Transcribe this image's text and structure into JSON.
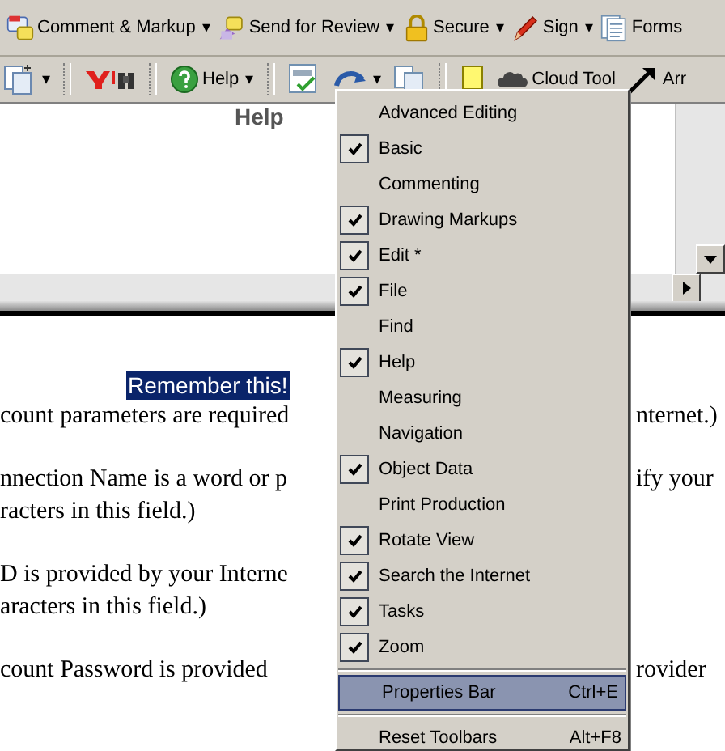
{
  "toolbar_top": [
    {
      "kind": "comment",
      "label": "Comment & Markup",
      "caret": "▾"
    },
    {
      "kind": "review",
      "label": "Send for Review",
      "caret": "▾"
    },
    {
      "kind": "lock",
      "label": "Secure",
      "caret": "▾"
    },
    {
      "kind": "pen",
      "label": "Sign",
      "caret": "▾"
    },
    {
      "kind": "forms",
      "label": "Forms"
    }
  ],
  "toolbar_second": [
    {
      "kind": "page",
      "caret": "▾"
    },
    {
      "kind": "sep"
    },
    {
      "kind": "search"
    },
    {
      "kind": "sep"
    },
    {
      "kind": "help",
      "label": "Help",
      "caret": "▾"
    },
    {
      "kind": "sep"
    },
    {
      "kind": "spell"
    },
    {
      "kind": "rotate",
      "caret": "▾"
    },
    {
      "kind": "copy"
    },
    {
      "kind": "sep"
    },
    {
      "kind": "note"
    },
    {
      "kind": "cloud",
      "label": "Cloud Tool"
    },
    {
      "kind": "arrow",
      "label": "Arr"
    }
  ],
  "upper_document": {
    "heading": "Help"
  },
  "document": {
    "highlight": "Remember this!",
    "paragraphs": [
      {
        "lines": [
          {
            "left": "count parameters are required",
            "right": "nternet.)"
          }
        ]
      },
      {
        "lines": [
          {
            "left": "nnection Name is a word or p",
            "right": "ify your"
          },
          {
            "left": "racters in this field.)"
          }
        ]
      },
      {
        "lines": [
          {
            "left": "D is provided by your Interne"
          },
          {
            "left": "aracters in this field.)"
          }
        ]
      },
      {
        "lines": [
          {
            "left": "count Password is provided",
            "right": "rovider"
          }
        ]
      }
    ]
  },
  "menu": {
    "items": [
      {
        "kind": "check",
        "label": "Advanced Editing",
        "checked": false,
        "selected": false
      },
      {
        "kind": "check",
        "label": "Basic",
        "checked": true,
        "selected": false
      },
      {
        "kind": "check",
        "label": "Commenting",
        "checked": false,
        "selected": false
      },
      {
        "kind": "check",
        "label": "Drawing Markups",
        "checked": true,
        "selected": false
      },
      {
        "kind": "check",
        "label": "Edit *",
        "checked": true,
        "selected": false
      },
      {
        "kind": "check",
        "label": "File",
        "checked": true,
        "selected": false
      },
      {
        "kind": "check",
        "label": "Find",
        "checked": false,
        "selected": false
      },
      {
        "kind": "check",
        "label": "Help",
        "checked": true,
        "selected": false
      },
      {
        "kind": "check",
        "label": "Measuring",
        "checked": false,
        "selected": false
      },
      {
        "kind": "check",
        "label": "Navigation",
        "checked": false,
        "selected": false
      },
      {
        "kind": "check",
        "label": "Object Data",
        "checked": true,
        "selected": false
      },
      {
        "kind": "check",
        "label": "Print Production",
        "checked": false,
        "selected": false
      },
      {
        "kind": "check",
        "label": "Rotate View",
        "checked": true,
        "selected": false
      },
      {
        "kind": "check",
        "label": "Search the Internet",
        "checked": true,
        "selected": false
      },
      {
        "kind": "check",
        "label": "Tasks",
        "checked": true,
        "selected": false
      },
      {
        "kind": "check",
        "label": "Zoom",
        "checked": true,
        "selected": false
      },
      {
        "kind": "separator"
      },
      {
        "kind": "command",
        "label": "Properties Bar",
        "shortcut": "Ctrl+E",
        "selected": true
      },
      {
        "kind": "separator"
      },
      {
        "kind": "command",
        "label": "Reset Toolbars",
        "shortcut": "Alt+F8",
        "selected": false
      }
    ]
  }
}
